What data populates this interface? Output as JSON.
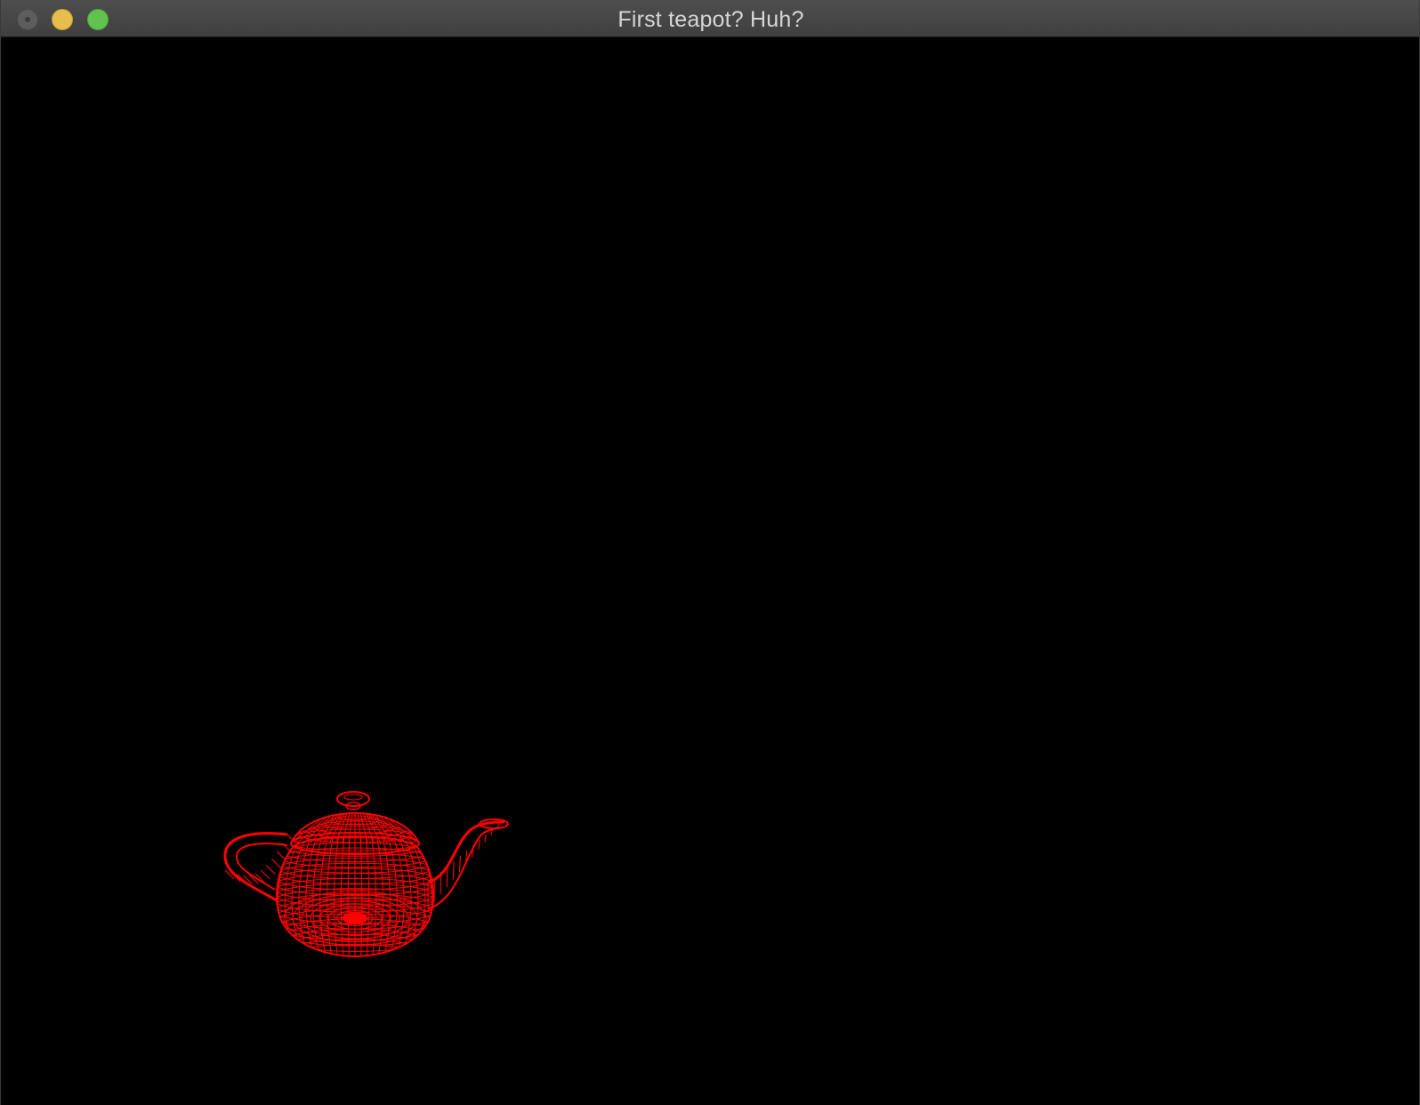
{
  "window": {
    "title": "First teapot? Huh?",
    "background": "#000000"
  },
  "titlebar": {
    "buttons": [
      {
        "name": "close",
        "color": "#5d5d5d"
      },
      {
        "name": "minimize",
        "color": "#e7bd4e"
      },
      {
        "name": "zoom",
        "color": "#61c24d"
      }
    ]
  },
  "scene": {
    "object": "teapot",
    "render_mode": "wireframe",
    "color": "#ff0000"
  }
}
